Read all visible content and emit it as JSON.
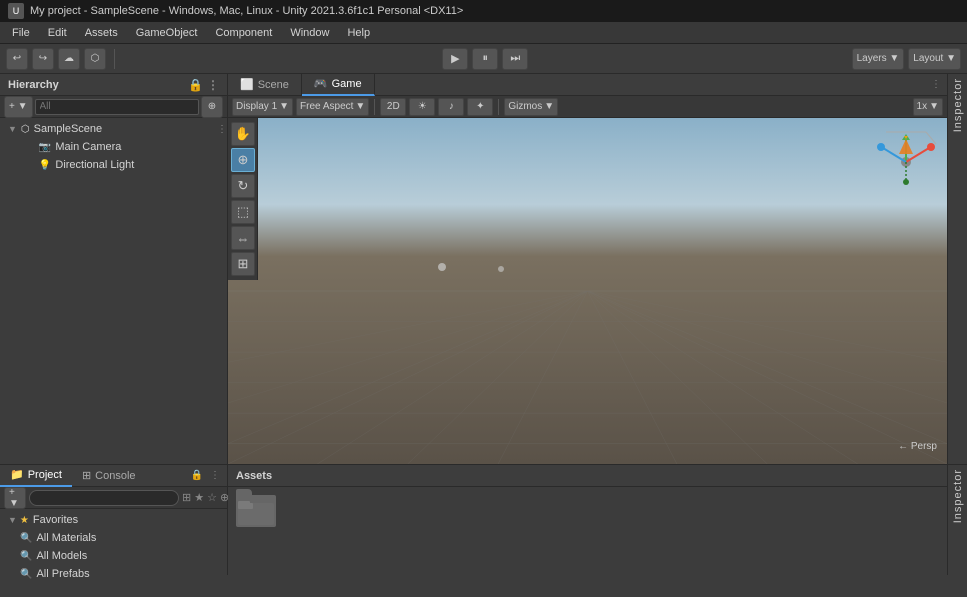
{
  "titleBar": {
    "title": "My project - SampleScene - Windows, Mac, Linux - Unity 2021.3.6f1c1 Personal <DX11>",
    "logo": "▶"
  },
  "menuBar": {
    "items": [
      "File",
      "Edit",
      "Assets",
      "GameObject",
      "Component",
      "Window",
      "Help"
    ]
  },
  "toolbar": {
    "playLabel": "▶",
    "pauseLabel": "⏸",
    "stepLabel": "⏭",
    "undoLabel": "↩",
    "redoLabel": "↪"
  },
  "hierarchy": {
    "title": "Hierarchy",
    "searchPlaceholder": "All",
    "addLabel": "+ ▼",
    "lockIcon": "🔒",
    "menuIcon": "⋮",
    "items": [
      {
        "label": "SampleScene",
        "indent": 0,
        "hasArrow": true,
        "icon": "⬡",
        "isOpen": true
      },
      {
        "label": "Main Camera",
        "indent": 1,
        "hasArrow": false,
        "icon": "📷"
      },
      {
        "label": "Directional Light",
        "indent": 1,
        "hasArrow": false,
        "icon": "💡"
      }
    ]
  },
  "sceneView": {
    "tabs": [
      {
        "label": "Scene",
        "icon": "⬜",
        "active": false
      },
      {
        "label": "Game",
        "icon": "🎮",
        "active": true
      }
    ],
    "tools": {
      "dropdown1Label": "▼",
      "dropdown2Label": "▼",
      "twoD": "2D",
      "lightingIcon": "☀",
      "audioIcon": "♪",
      "effectsIcon": "✦",
      "gizmosLabel": "Gizmos ▼",
      "scaleLabel": "1x ▼"
    },
    "leftTools": [
      "✋",
      "⊕",
      "↻",
      "⬚",
      "⇔",
      "⊞"
    ],
    "perspLabel": "← Persp"
  },
  "projectPanel": {
    "title": "Project",
    "tabs": [
      {
        "label": "Project",
        "icon": "📁",
        "active": true
      },
      {
        "label": "Console",
        "icon": "⊞",
        "active": false
      }
    ],
    "toolbar": {
      "addLabel": "+ ▼",
      "searchPlaceholder": ""
    },
    "tree": {
      "favoritesLabel": "Favorites",
      "favoritesOpen": true,
      "items": [
        {
          "label": "All Materials",
          "icon": "🔍"
        },
        {
          "label": "All Models",
          "icon": "🔍"
        },
        {
          "label": "All Prefabs",
          "icon": "🔍"
        }
      ]
    }
  },
  "assetsPanel": {
    "title": "Assets",
    "items": [
      {
        "type": "folder",
        "label": ""
      }
    ],
    "iconCount": "16"
  },
  "inspector": {
    "label": "Inspector"
  },
  "colors": {
    "accent": "#4c9be8",
    "selected": "#2c5f8a",
    "bg": "#3c3c3c",
    "darkBg": "#2a2a2a",
    "panelBg": "#383838"
  }
}
